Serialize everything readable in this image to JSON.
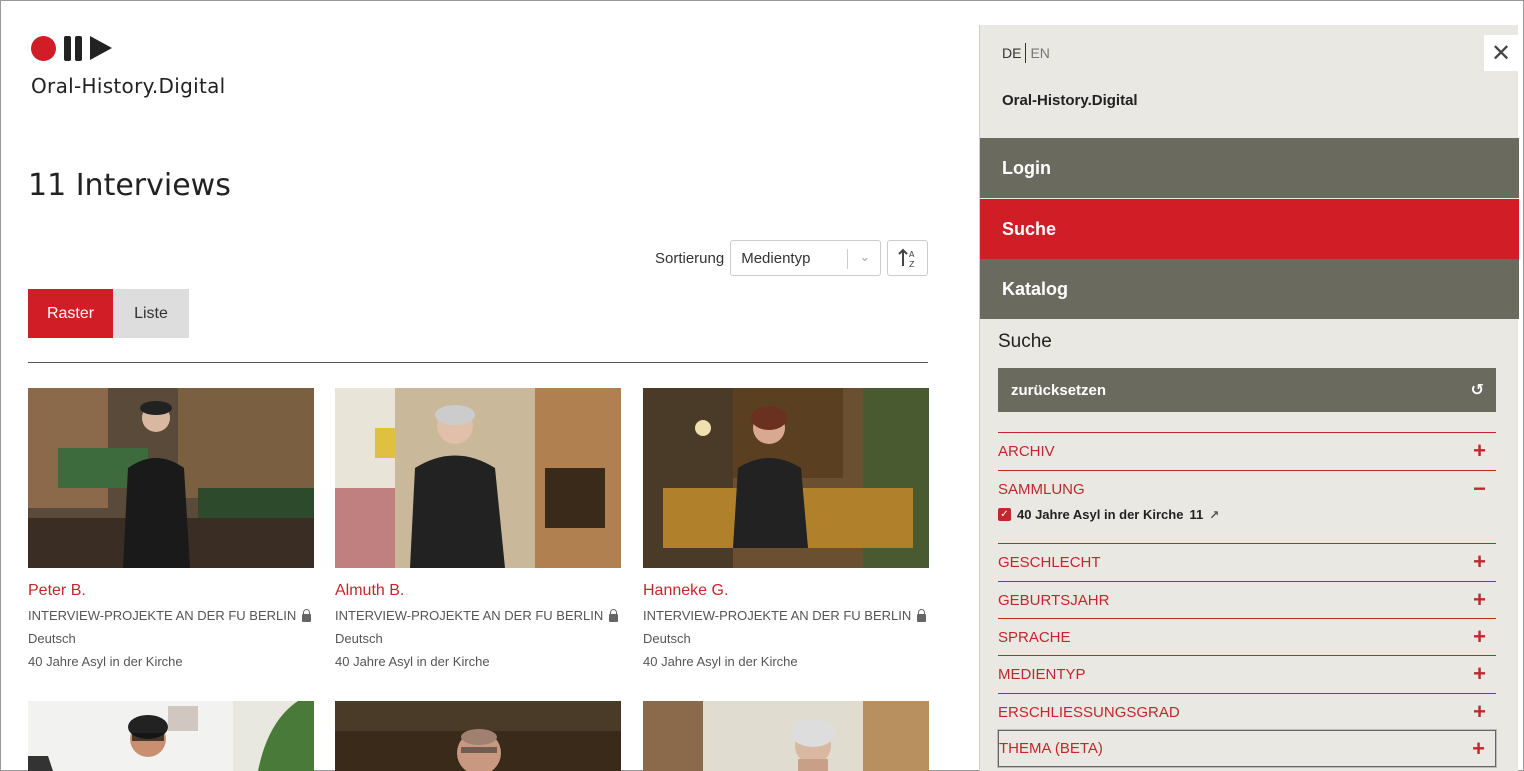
{
  "logo": {
    "text": "Oral-History.Digital"
  },
  "main": {
    "title": "11 Interviews",
    "sort_label": "Sortierung",
    "sort_value": "Medientyp",
    "view_modes": [
      "Raster",
      "Liste"
    ],
    "active_view": "Raster"
  },
  "interviews": [
    {
      "name": "Peter B.",
      "project": "INTERVIEW-PROJEKTE AN DER FU BERLIN",
      "language": "Deutsch",
      "collection": "40 Jahre Asyl in der Kirche"
    },
    {
      "name": "Almuth B.",
      "project": "INTERVIEW-PROJEKTE AN DER FU BERLIN",
      "language": "Deutsch",
      "collection": "40 Jahre Asyl in der Kirche"
    },
    {
      "name": "Hanneke G.",
      "project": "INTERVIEW-PROJEKTE AN DER FU BERLIN",
      "language": "Deutsch",
      "collection": "40 Jahre Asyl in der Kirche"
    },
    {
      "name": "",
      "project": "",
      "language": "",
      "collection": ""
    },
    {
      "name": "",
      "project": "",
      "language": "",
      "collection": ""
    },
    {
      "name": "",
      "project": "",
      "language": "",
      "collection": ""
    }
  ],
  "panel": {
    "lang_de": "DE",
    "lang_en": "EN",
    "close": "✕",
    "brand": "Oral-History.Digital",
    "nav": [
      "Login",
      "Suche",
      "Katalog"
    ],
    "search_title": "Suche",
    "reset_label": "zurücksetzen",
    "facets": [
      "ARCHIV",
      "SAMMLUNG",
      "GESCHLECHT",
      "GEBURTSJAHR",
      "SPRACHE",
      "MEDIENTYP",
      "ERSCHLIESSUNGSGRAD",
      "THEMA (BETA)"
    ],
    "sammlung_item": {
      "label": "40 Jahre Asyl in der Kirche",
      "count": "11"
    }
  },
  "colors": {
    "accent": "#d11e26",
    "nav_gray": "#6b6a5f",
    "panel_bg": "#e9e8e3"
  }
}
